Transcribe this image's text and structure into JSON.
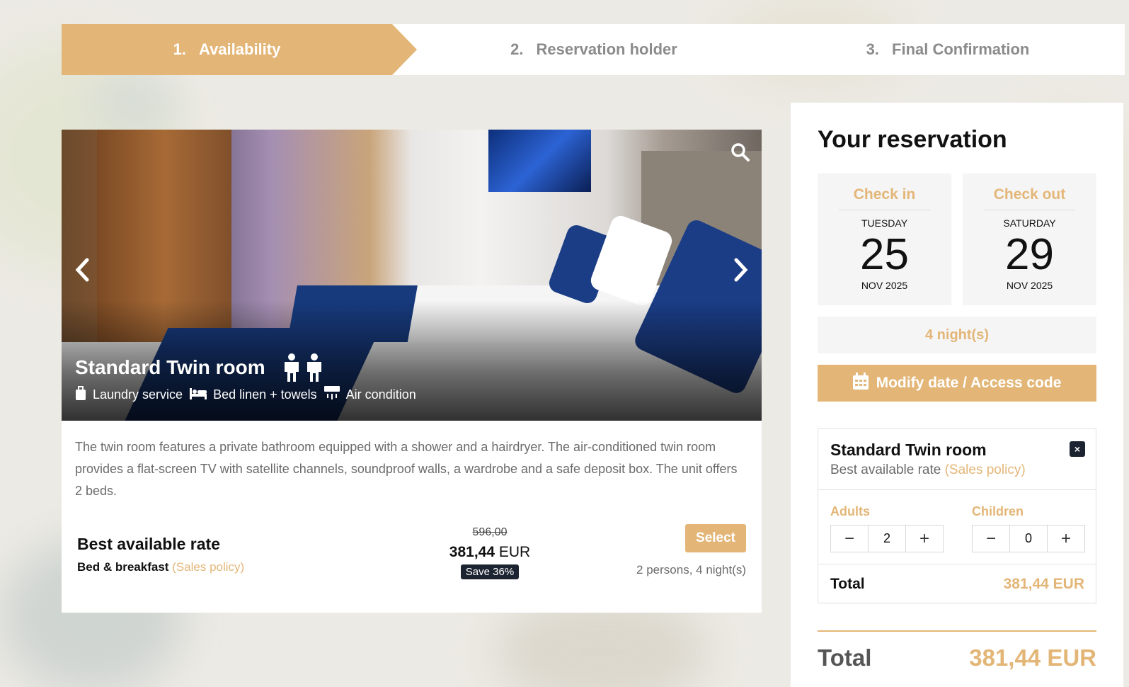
{
  "steps": [
    {
      "num": "1.",
      "label": "Availability"
    },
    {
      "num": "2.",
      "label": "Reservation holder"
    },
    {
      "num": "3.",
      "label": "Final Confirmation"
    }
  ],
  "room": {
    "title": "Standard Twin room",
    "amenities": [
      "Laundry service",
      "Bed linen + towels",
      "Air condition"
    ],
    "description": "The twin room features a private bathroom equipped with a shower and a hairdryer. The air-conditioned twin room provides a flat-screen TV with satellite channels, soundproof walls, a wardrobe and a safe deposit box. The unit offers 2 beds.",
    "rate": {
      "name": "Best available rate",
      "board": "Bed & breakfast",
      "policy": "(Sales policy)",
      "old_price": "596,00",
      "new_price": "381,44",
      "currency": "EUR",
      "save": "Save 36%",
      "select_label": "Select",
      "meta": "2 persons, 4 night(s)"
    }
  },
  "reservation": {
    "title": "Your reservation",
    "checkin": {
      "label": "Check in",
      "dow": "TUESDAY",
      "day": "25",
      "month_year": "NOV 2025"
    },
    "checkout": {
      "label": "Check out",
      "dow": "SATURDAY",
      "day": "29",
      "month_year": "NOV 2025"
    },
    "nights": "4 night(s)",
    "modify_label": "Modify date / Access code",
    "selected": {
      "title": "Standard Twin room",
      "rate": "Best available rate",
      "policy": "(Sales policy)",
      "remove": "×",
      "adults_label": "Adults",
      "adults": "2",
      "children_label": "Children",
      "children": "0",
      "minus": "−",
      "plus": "+",
      "total_label": "Total",
      "total": "381,44 EUR"
    },
    "grand_total_label": "Total",
    "grand_total": "381,44 EUR"
  },
  "colors": {
    "accent": "#e3b677",
    "dark": "#1d2431"
  },
  "icons": [
    "search-icon",
    "chevron-left-icon",
    "chevron-right-icon",
    "person-icon",
    "laundry-icon",
    "bed-icon",
    "air-condition-icon",
    "calendar-icon",
    "close-icon",
    "minus-icon",
    "plus-icon"
  ]
}
